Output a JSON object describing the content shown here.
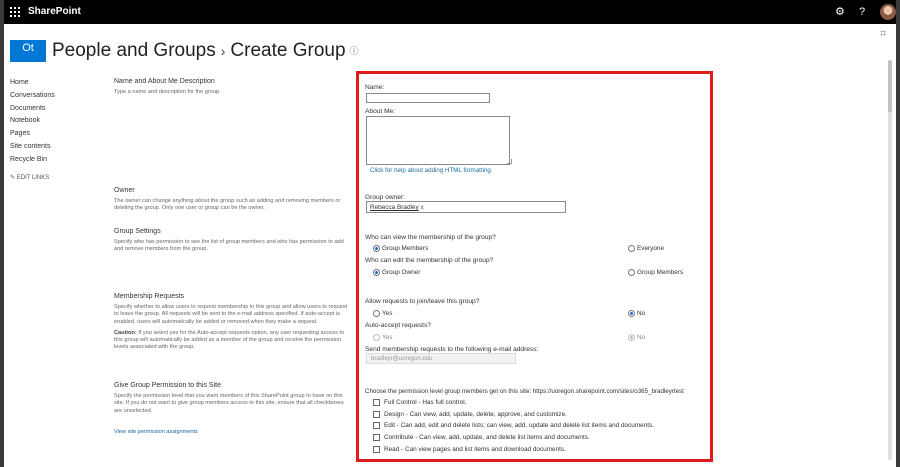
{
  "suitebar": {
    "app_name": "SharePoint",
    "settings_glyph": "⚙",
    "help_glyph": "?",
    "waffle_icon": "app-launcher-icon",
    "avatar_icon": "user-avatar"
  },
  "site": {
    "logo_text": "Ot"
  },
  "header": {
    "title_part1": "People and Groups",
    "separator": "›",
    "title_part2": "Create Group",
    "info_glyph": "ⓘ",
    "focus_glyph": "⌗"
  },
  "leftnav": {
    "items": [
      "Home",
      "Conversations",
      "Documents",
      "Notebook",
      "Pages",
      "Site contents",
      "Recycle Bin"
    ],
    "edit_glyph": "✎",
    "edit_links": "EDIT LINKS"
  },
  "sections": {
    "name": {
      "heading": "Name and About Me Description",
      "text": "Type a name and description for the group."
    },
    "owner": {
      "heading": "Owner",
      "text": "The owner can change anything about the group such as adding and removing members or deleting the group. Only one user or group can be the owner."
    },
    "settings": {
      "heading": "Group Settings",
      "text": "Specify who has permission to see the list of group members and who has permission to add and remove members from the group."
    },
    "membership": {
      "heading": "Membership Requests",
      "text": "Specify whether to allow users to request membership in this group and allow users to request to leave the group. All requests will be sent to the e-mail address specified. If auto-accept is enabled, users will automatically be added or removed when they make a request.",
      "caution_label": "Caution:",
      "caution_text": " If you select yes for the Auto-accept requests option, any user requesting access to this group will automatically be added as a member of the group and receive the permission levels associated with the group."
    },
    "permission": {
      "heading": "Give Group Permission to this Site",
      "text": "Specify the permission level that you want members of this SharePoint group to have on this site. If you do not want to give group members access to this site, ensure that all checkboxes are unselected.",
      "link": "View site permission assignments"
    }
  },
  "form": {
    "name_label": "Name:",
    "name_value": "",
    "about_label": "About Me:",
    "about_value": "",
    "html_help_link": "Click for help about adding HTML formatting.",
    "owner_label": "Group owner:",
    "owner_value": "Rebecca Bradley",
    "owner_remove": "x",
    "view_question": "Who can view the membership of the group?",
    "view_options": [
      "Group Members",
      "Everyone"
    ],
    "view_selected": "Group Members",
    "edit_question": "Who can edit the membership of the group?",
    "edit_options": [
      "Group Owner",
      "Group Members"
    ],
    "edit_selected": "Group Owner",
    "join_question": "Allow requests to join/leave this group?",
    "join_options": [
      "Yes",
      "No"
    ],
    "join_selected": "No",
    "autoaccept_question": "Auto-accept requests?",
    "autoaccept_options": [
      "Yes",
      "No"
    ],
    "autoaccept_selected": "No",
    "email_label": "Send membership requests to the following e-mail address:",
    "email_value": "bradleyr@uoregon.edu",
    "permission_prompt": "Choose the permission level group members get on this site: https://uoregon.sharepoint.com/sites/o365_bradleyrtest",
    "permissions": [
      "Full Control - Has full control.",
      "Design - Can view, add, update, delete, approve, and customize.",
      "Edit - Can add, edit and delete lists; can view, add, update and delete list items and documents.",
      "Contribute - Can view, add, update, and delete list items and documents.",
      "Read - Can view pages and list items and download documents."
    ]
  },
  "colors": {
    "suitebar": "#000000",
    "highlight_border": "#e01b1b",
    "site_logo": "#0078d4",
    "link": "#1a6fa0",
    "radio_selected": "#1a6fd1"
  }
}
